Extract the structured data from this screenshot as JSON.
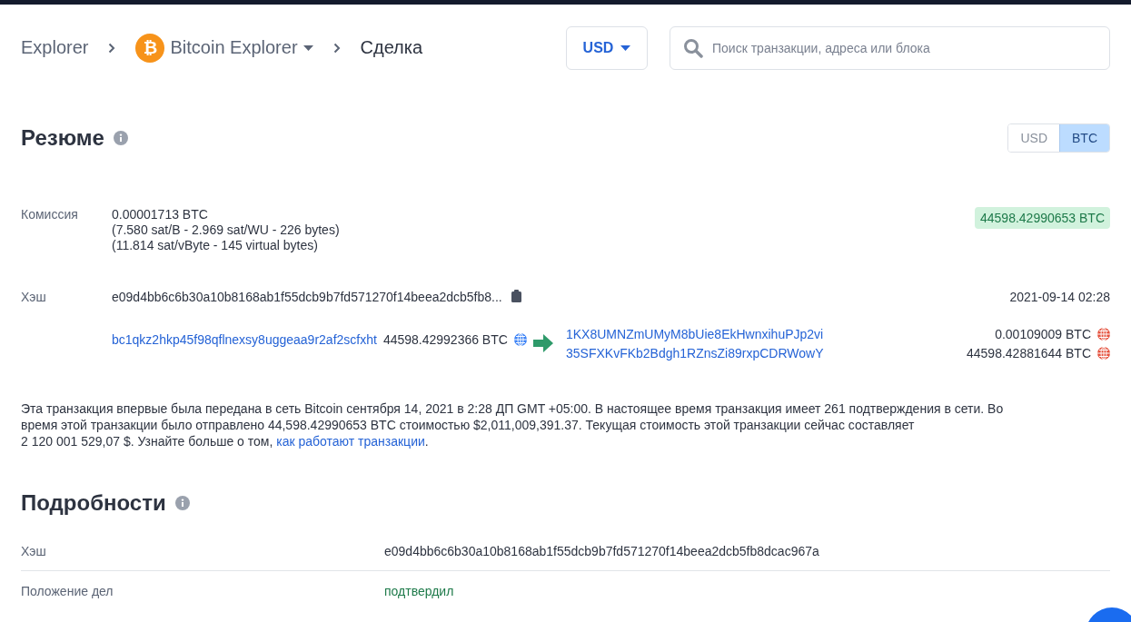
{
  "breadcrumb": [
    {
      "kind": "link",
      "label": "Explorer"
    },
    {
      "kind": "dropdown",
      "label": "Bitcoin Explorer",
      "logo": "₿"
    },
    {
      "kind": "current",
      "label": "Сделка"
    }
  ],
  "currency_select": {
    "value": "USD"
  },
  "search": {
    "placeholder": "Поиск транзакции, адреса или блока"
  },
  "summary": {
    "title": "Резюме",
    "unit_toggle": [
      {
        "label": "USD",
        "selected": false
      },
      {
        "label": "BTC",
        "selected": true
      }
    ],
    "fee": {
      "label": "Комиссия",
      "lines": [
        "0.00001713 BTC",
        "(7.580 sat/B - 2.969 sat/WU - 226 bytes)",
        "(11.814 sat/vByte - 145 virtual bytes)"
      ],
      "total": "44598.42990653 BTC"
    },
    "hash": {
      "label": "Хэш",
      "value": "e09d4bb6c6b30a10b8168ab1f55dcb9b7fd571270f14beea2dcb5fb8...",
      "time": "2021-09-14 02:28"
    },
    "inputs": [
      {
        "address": "bc1qkz2hkp45f98qflnexsy8uggeaa9r2af2scfxht",
        "amount": "44598.42992366 BTC",
        "color": "#3b82f6"
      }
    ],
    "outputs": [
      {
        "address": "1KX8UMNZmUMyM8bUie8EkHwnxihuPJp2vi",
        "amount": "0.00109009 BTC",
        "color": "#e5533f"
      },
      {
        "address": "35SFXKvFKb2Bdgh1RZnsZi89rxpCDRWowY",
        "amount": "44598.42881644 BTC",
        "color": "#e5533f"
      }
    ],
    "description": {
      "lines": [
        "Эта транзакция впервые была передана в сеть Bitcoin сентября 14, 2021 в 2:28 ДП GMT +05:00.  В настоящее время транзакция имеет 261 подтверждения в сети.  Во",
        "время этой транзакции было отправлено 44,598.42990653 BTC стоимостью $2,011,009,391.37. Текущая стоимость этой транзакции сейчас составляет",
        "2 120 001 529,07 $.  Узнайте больше о том, "
      ],
      "link": "как работают транзакции",
      "tail": "."
    }
  },
  "details": {
    "title": "Подробности",
    "rows": [
      {
        "label": "Хэш",
        "value": "e09d4bb6c6b30a10b8168ab1f55dcb9b7fd571270f14beea2dcb5fb8dcac967a",
        "kind": "plain"
      },
      {
        "label": "Положение дел",
        "value": "подтвердил",
        "kind": "status"
      }
    ]
  }
}
